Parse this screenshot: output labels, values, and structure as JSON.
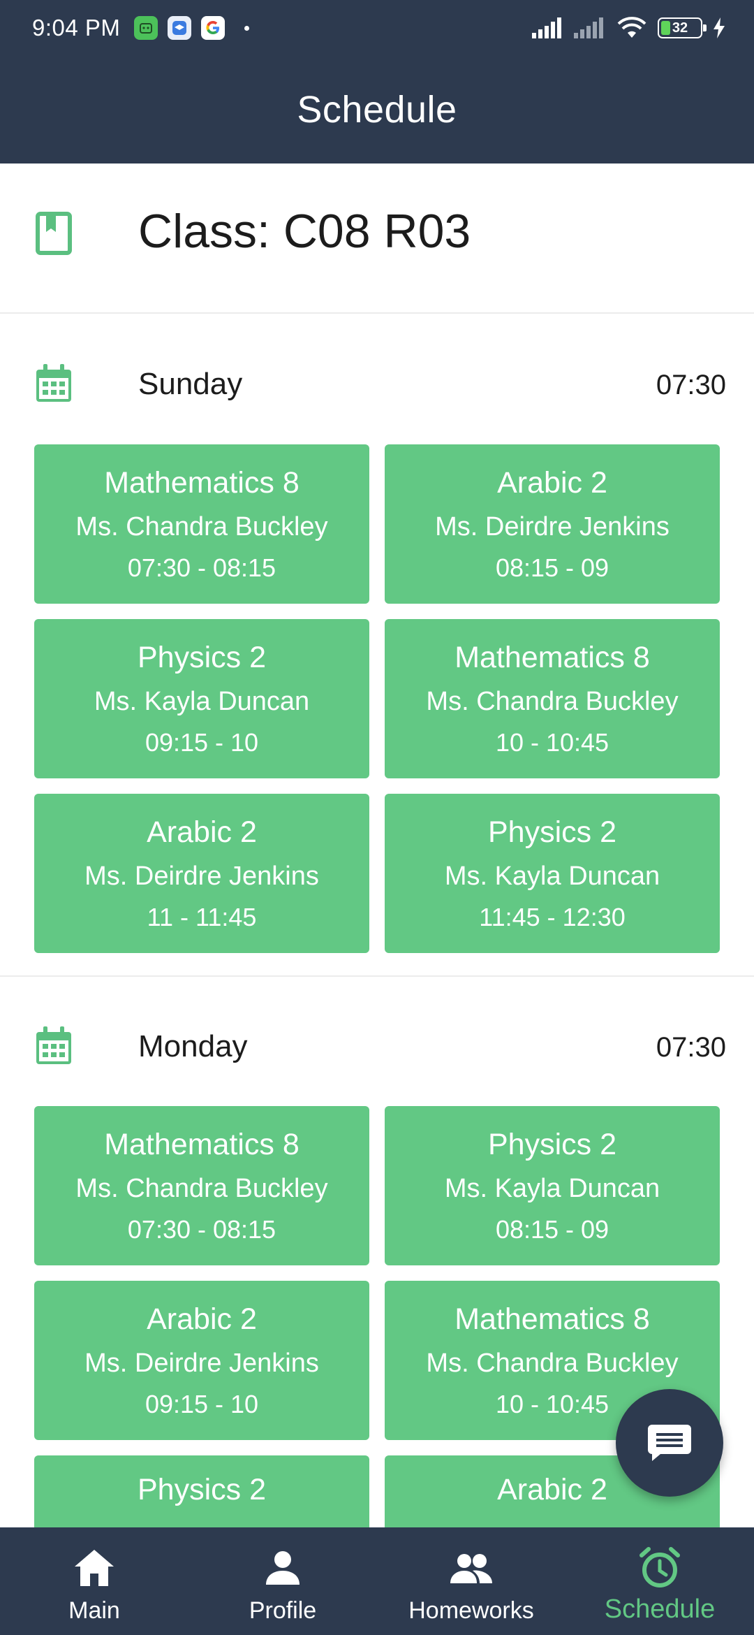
{
  "status_bar": {
    "time": "9:04 PM",
    "battery_level": "32",
    "battery_fraction": 0.32
  },
  "header": {
    "title": "Schedule"
  },
  "class_info": {
    "label": "Class: C08 R03"
  },
  "days": [
    {
      "name": "Sunday",
      "start_time": "07:30",
      "lessons": [
        {
          "subject": "Mathematics 8",
          "teacher": "Ms. Chandra Buckley",
          "time": "07:30 - 08:15"
        },
        {
          "subject": "Arabic 2",
          "teacher": "Ms. Deirdre Jenkins",
          "time": "08:15 - 09"
        },
        {
          "subject": "Physics 2",
          "teacher": "Ms. Kayla Duncan",
          "time": "09:15 - 10"
        },
        {
          "subject": "Mathematics 8",
          "teacher": "Ms. Chandra Buckley",
          "time": "10 - 10:45"
        },
        {
          "subject": "Arabic 2",
          "teacher": "Ms. Deirdre Jenkins",
          "time": "11 - 11:45"
        },
        {
          "subject": "Physics 2",
          "teacher": "Ms. Kayla Duncan",
          "time": "11:45 - 12:30"
        }
      ]
    },
    {
      "name": "Monday",
      "start_time": "07:30",
      "lessons": [
        {
          "subject": "Mathematics 8",
          "teacher": "Ms. Chandra Buckley",
          "time": "07:30 - 08:15"
        },
        {
          "subject": "Physics 2",
          "teacher": "Ms. Kayla Duncan",
          "time": "08:15 - 09"
        },
        {
          "subject": "Arabic 2",
          "teacher": "Ms. Deirdre Jenkins",
          "time": "09:15 - 10"
        },
        {
          "subject": "Mathematics 8",
          "teacher": "Ms. Chandra Buckley",
          "time": "10 - 10:45"
        },
        {
          "subject": "Physics 2",
          "teacher": "",
          "time": ""
        },
        {
          "subject": "Arabic 2",
          "teacher": "",
          "time": ""
        }
      ]
    }
  ],
  "bottom_nav": {
    "items": [
      {
        "label": "Main",
        "icon": "home-icon"
      },
      {
        "label": "Profile",
        "icon": "person-icon"
      },
      {
        "label": "Homeworks",
        "icon": "group-icon"
      },
      {
        "label": "Schedule",
        "icon": "alarm-clock-icon",
        "active": true
      }
    ]
  },
  "colors": {
    "header_bg": "#2d3a4f",
    "accent_green": "#62c884",
    "icon_green": "#5bbf80"
  }
}
